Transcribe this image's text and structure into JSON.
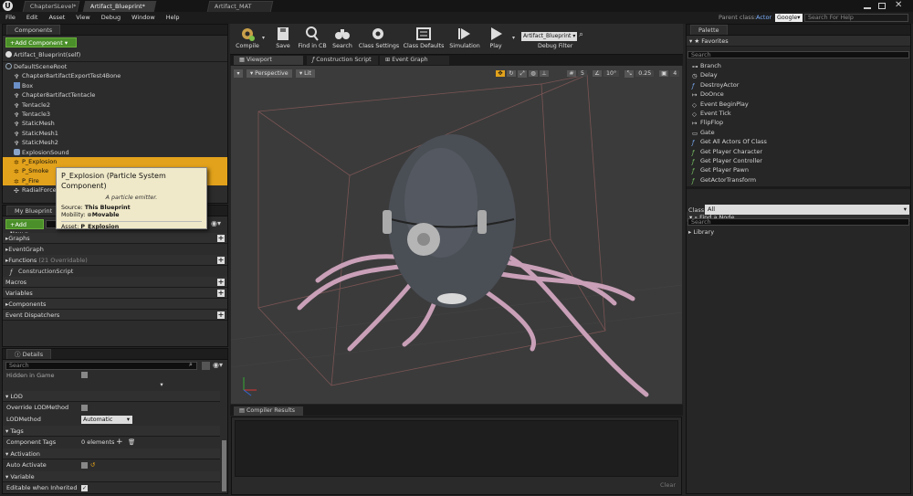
{
  "window": {
    "tabs": [
      "ChapterSLevel*",
      "Artifact_Blueprint*",
      "Artifact_MAT"
    ],
    "parent_class_label": "Parent class:",
    "parent_class_value": "Actor",
    "search_engine": "Google",
    "search_placeholder": "Search For Help"
  },
  "menu": [
    "File",
    "Edit",
    "Asset",
    "View",
    "Debug",
    "Window",
    "Help"
  ],
  "components": {
    "title": "Components",
    "add_button": "+Add Component",
    "self_label": "Artifact_Blueprint(self)",
    "items": [
      "DefaultSceneRoot",
      "Chapter8artifactExportTest4Bone",
      "Box",
      "Chapter8artifactTentacle",
      "Tentacle2",
      "Tentacle3",
      "StaticMesh",
      "StaticMesh1",
      "StaticMesh2",
      "ExplosionSound",
      "P_Explosion",
      "P_Smoke",
      "P_Fire",
      "RadialForce"
    ]
  },
  "tooltip": {
    "title": "P_Explosion (Particle System Component)",
    "description": "A particle emitter.",
    "source_label": "Source:",
    "source_value": "This Blueprint",
    "mobility_label": "Mobility:",
    "mobility_value": "Movable",
    "asset_label": "Asset:",
    "asset_value": "P_Explosion"
  },
  "my_blueprint": {
    "title": "My Blueprint",
    "add_new": "Add New",
    "sections": {
      "graphs": "Graphs",
      "event_graph": "EventGraph",
      "functions": "Functions",
      "functions_count": "(21 Overridable)",
      "construction_script": "ConstructionScript",
      "macros": "Macros",
      "variables": "Variables",
      "components": "Components",
      "event_dispatchers": "Event Dispatchers"
    }
  },
  "details": {
    "title": "Details",
    "search_placeholder": "Search",
    "hidden_in_game": "Hidden in Game",
    "lod_header": "LOD",
    "override_lod": "Override LODMethod",
    "lod_method_label": "LODMethod",
    "lod_method_value": "Automatic",
    "tags_header": "Tags",
    "component_tags_label": "Component Tags",
    "component_tags_value": "0 elements",
    "activation_header": "Activation",
    "auto_activate_label": "Auto Activate",
    "variable_header": "Variable",
    "editable_label": "Editable when Inherited"
  },
  "toolbar": {
    "compile": "Compile",
    "save": "Save",
    "find_in_cb": "Find in CB",
    "search": "Search",
    "class_settings": "Class Settings",
    "class_defaults": "Class Defaults",
    "simulation": "Simulation",
    "play": "Play",
    "debug_object": "Artifact_Blueprint",
    "debug_filter": "Debug Filter"
  },
  "viewport": {
    "tabs": [
      "Viewport",
      "Construction Script",
      "Event Graph"
    ],
    "perspective": "Perspective",
    "lit": "Lit",
    "grid_value": "5",
    "angle_value": "10°",
    "scale_value": "0.25",
    "cam_speed": "4"
  },
  "compiler": {
    "title": "Compiler Results",
    "clear": "Clear"
  },
  "palette": {
    "title": "Palette",
    "favorites": "Favorites",
    "search_placeholder": "Search",
    "items": [
      "Branch",
      "Delay",
      "DestroyActor",
      "DoOnce",
      "Event BeginPlay",
      "Event Tick",
      "FlipFlop",
      "Gate",
      "Get All Actors Of Class",
      "Get Player Character",
      "Get Player Controller",
      "Get Player Pawn",
      "GetActorTransform"
    ],
    "find_node": "Find a Node",
    "class_label": "Class:",
    "class_value": "All",
    "search2_placeholder": "Search",
    "library": "Library"
  },
  "colors": {
    "selection": "#e2a21b",
    "accent_green": "#4a8f2a",
    "tooltip_bg": "#f0e9c9"
  }
}
